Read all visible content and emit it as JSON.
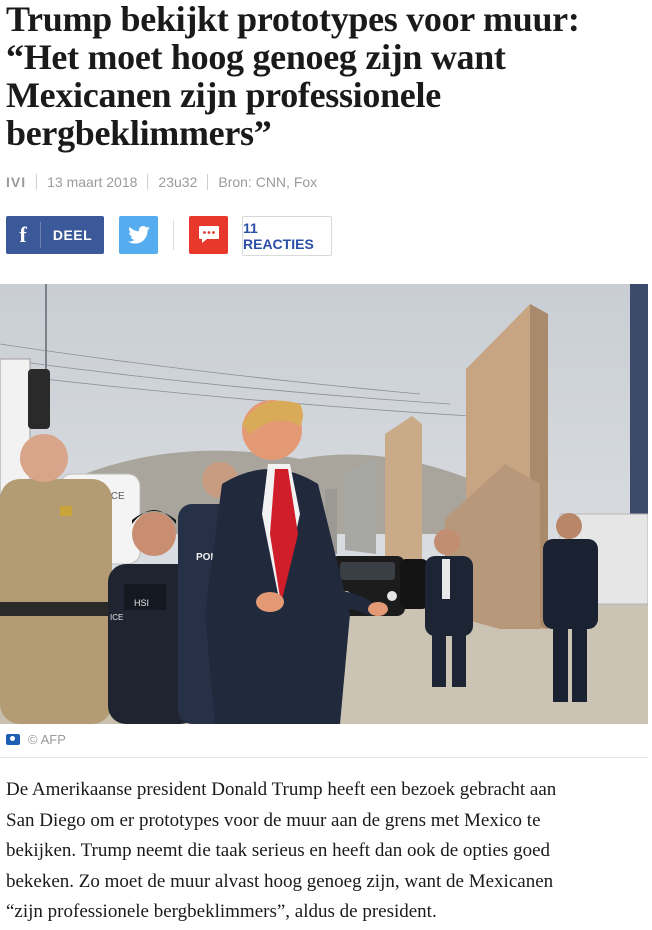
{
  "article": {
    "headline_lines": [
      "Trump bekijkt prototypes voor muur:",
      "“Het moet hoog genoeg zijn want",
      "Mexicanen zijn professionele",
      "bergbeklimmers”"
    ],
    "meta": {
      "brand": "IVI",
      "date": "13 maart 2018",
      "time": "23u32",
      "source": "Bron: CNN, Fox"
    },
    "share": {
      "facebook_label": "DEEL",
      "reactions_label": "11 REACTIES"
    },
    "photo": {
      "credit_symbol": "©",
      "credit": "AFP",
      "visible_text": {
        "truck_badge": "POLICE",
        "vest_left": "POLICE",
        "hsi_badge": "HSI",
        "ice_patch": "ICE"
      }
    },
    "lead_lines": [
      "De Amerikaanse president Donald Trump heeft een bezoek gebracht aan",
      "San Diego om er prototypes voor de muur aan de grens met Mexico te",
      "bekijken. Trump neemt die taak serieus en heeft dan ook de opties goed",
      "bekeken. Zo moet de muur alvast hoog genoeg zijn, want de Mexicanen",
      "“zijn professionele bergbeklimmers”, aldus de president."
    ]
  },
  "colors": {
    "facebook": "#3b5998",
    "twitter": "#55acee",
    "comment": "#e8372b",
    "reactions_text": "#2a4fa7",
    "meta_text": "#9a9a9a"
  },
  "icons": [
    "facebook-icon",
    "twitter-bird-icon",
    "comment-bubble-icon",
    "camera-icon"
  ]
}
